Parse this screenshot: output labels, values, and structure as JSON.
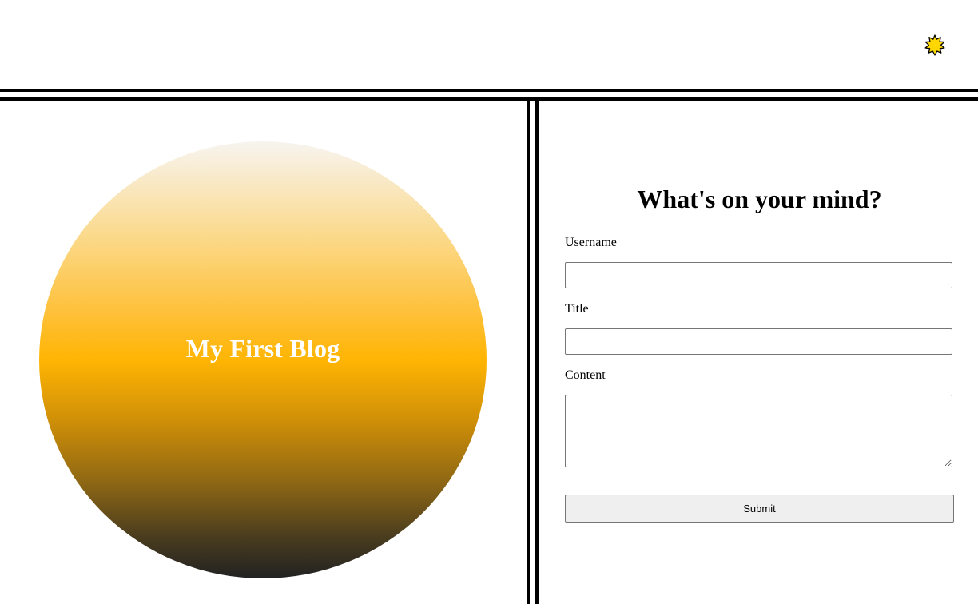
{
  "header": {
    "theme_toggle_icon": "sun-icon",
    "theme_toggle_color": "#ffd700"
  },
  "hero": {
    "title": "My First Blog"
  },
  "form": {
    "heading": "What's on your mind?",
    "username_label": "Username",
    "username_value": "",
    "title_label": "Title",
    "title_value": "",
    "content_label": "Content",
    "content_value": "",
    "submit_label": "Submit"
  }
}
